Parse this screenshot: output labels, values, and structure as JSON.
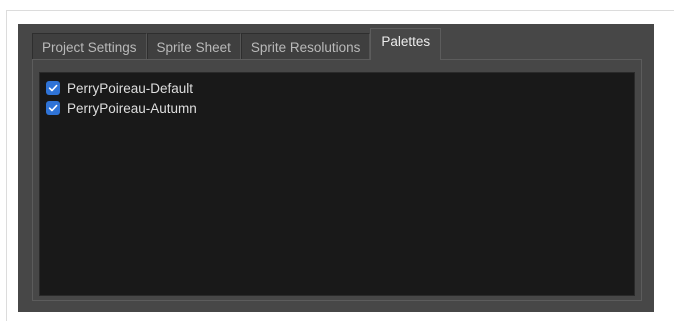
{
  "tabs": [
    {
      "label": "Project Settings",
      "active": false
    },
    {
      "label": "Sprite Sheet",
      "active": false
    },
    {
      "label": "Sprite Resolutions",
      "active": false
    },
    {
      "label": "Palettes",
      "active": true
    }
  ],
  "palettes": [
    {
      "label": "PerryPoireau-Default",
      "checked": true
    },
    {
      "label": "PerryPoireau-Autumn",
      "checked": true
    }
  ],
  "colors": {
    "dialog_bg": "#474747",
    "list_bg": "#191919",
    "checkbox_accent": "#2f73d6"
  },
  "icons": {
    "checkbox_checked": "checkmark-icon"
  }
}
